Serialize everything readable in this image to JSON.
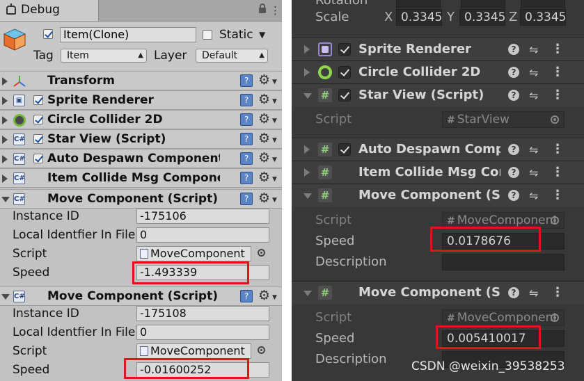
{
  "left_panel": {
    "tab": {
      "label": "Debug"
    },
    "gameobject": {
      "active": true,
      "name": "Item(Clone)",
      "static_label": "Static",
      "static_checked": false,
      "tag_label": "Tag",
      "tag_value": "Item",
      "layer_label": "Layer",
      "layer_value": "Default"
    },
    "components": [
      {
        "title": "Transform",
        "expanded": false,
        "has_checkbox": false
      },
      {
        "title": "Sprite Renderer",
        "expanded": false,
        "has_checkbox": true,
        "enabled": true
      },
      {
        "title": "Circle Collider 2D",
        "expanded": false,
        "has_checkbox": true,
        "enabled": true
      },
      {
        "title": "Star View (Script)",
        "expanded": false,
        "has_checkbox": true,
        "enabled": true
      },
      {
        "title": "Auto Despawn Component",
        "expanded": false,
        "has_checkbox": true,
        "enabled": true
      },
      {
        "title": "Item Collide Msg Component",
        "expanded": false,
        "has_checkbox": false
      }
    ],
    "move_components": [
      {
        "title": "Move Component (Script)",
        "instance_id_label": "Instance ID",
        "instance_id": "-175106",
        "local_id_label": "Local Identfier In File",
        "local_id": "0",
        "script_label": "Script",
        "script_value": "MoveComponent",
        "speed_label": "Speed",
        "speed_value": "-1.493339"
      },
      {
        "title": "Move Component (Script)",
        "instance_id_label": "Instance ID",
        "instance_id": "-175108",
        "local_id_label": "Local Identfier In File",
        "local_id": "0",
        "script_label": "Script",
        "script_value": "MoveComponent",
        "speed_label": "Speed",
        "speed_value": "-0.01600252"
      }
    ]
  },
  "right_panel": {
    "rotation_label": "Rotation",
    "scale": {
      "label": "Scale",
      "x_label": "X",
      "x": "0.3345",
      "y_label": "Y",
      "y": "0.3345",
      "z_label": "Z",
      "z": "0.3345"
    },
    "components": [
      {
        "title": "Sprite Renderer",
        "icon": "sprite-icon"
      },
      {
        "title": "Circle Collider 2D",
        "icon": "circle-collider-icon"
      },
      {
        "title": "Star View (Script)",
        "icon": "script-icon",
        "script_label": "Script",
        "script_value": "StarView"
      },
      {
        "title": "Auto Despawn Component",
        "icon": "script-icon"
      },
      {
        "title": "Item Collide Msg Component",
        "icon": "script-icon"
      }
    ],
    "move_components": [
      {
        "title": "Move Component (Script)",
        "script_label": "Script",
        "script_value": "MoveComponent",
        "speed_label": "Speed",
        "speed_value": "0.0178676",
        "description_label": "Description",
        "description_value": ""
      },
      {
        "title": "Move Component (Script)",
        "script_label": "Script",
        "script_value": "MoveComponent",
        "speed_label": "Speed",
        "speed_value": "0.005410017",
        "description_label": "Description",
        "description_value": ""
      }
    ]
  },
  "watermark": "CSDN @weixin_39538253",
  "colors": {
    "highlight": "#e0141b",
    "light_bg": "#c2c2c2",
    "dark_bg": "#383838",
    "collider_green": "#8fd64c"
  }
}
